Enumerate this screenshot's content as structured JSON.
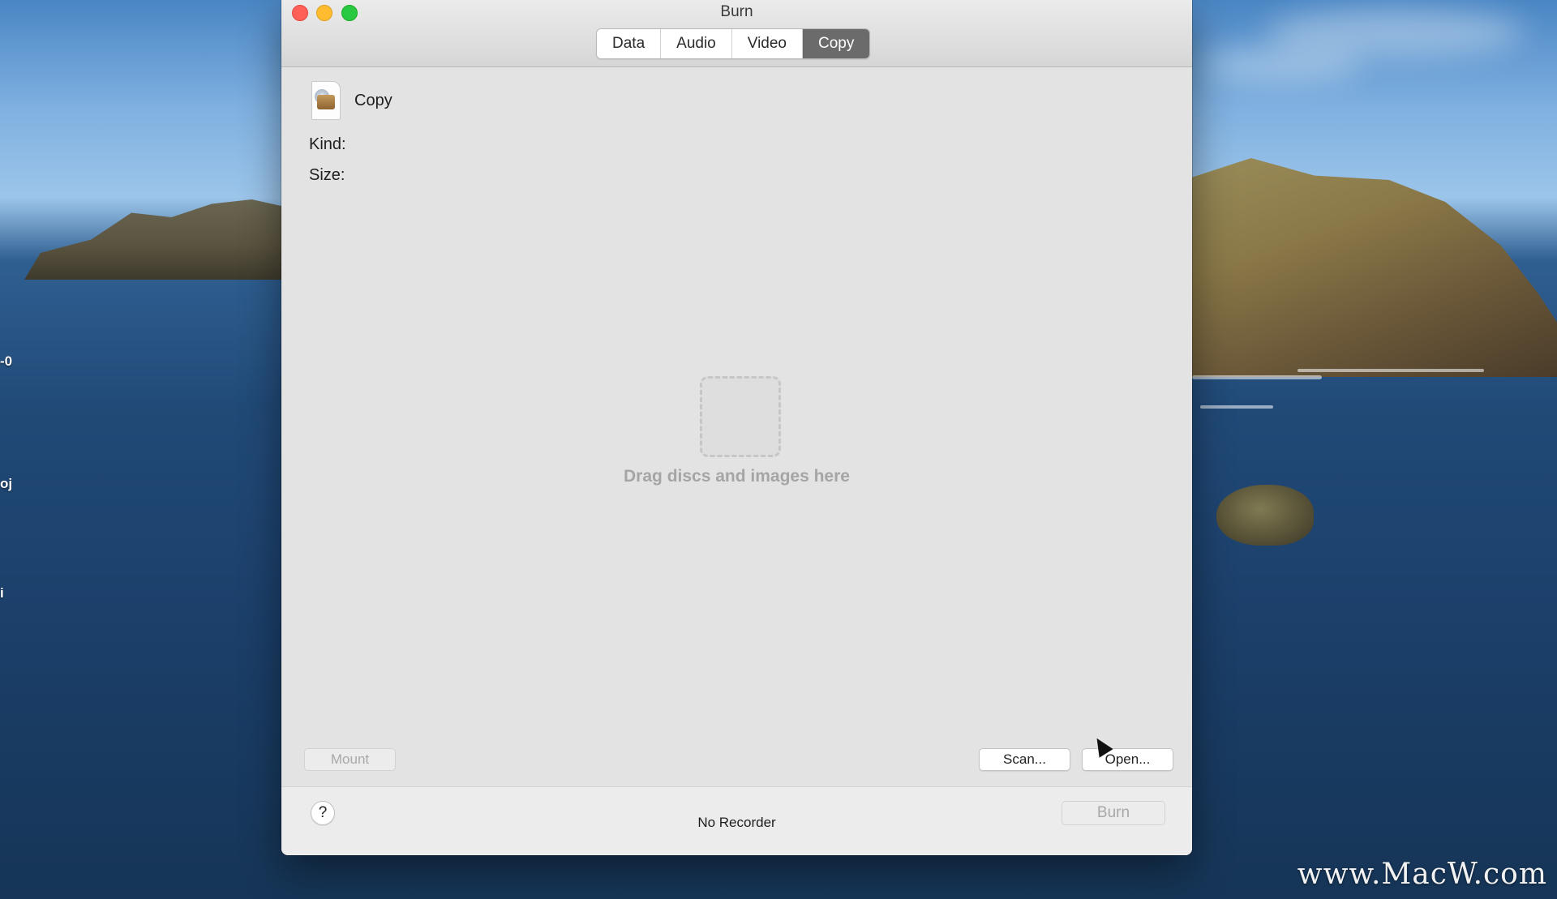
{
  "window": {
    "title": "Burn",
    "tabs": [
      {
        "label": "Data",
        "active": false
      },
      {
        "label": "Audio",
        "active": false
      },
      {
        "label": "Video",
        "active": false
      },
      {
        "label": "Copy",
        "active": true
      }
    ]
  },
  "copy_panel": {
    "item_name": "Copy",
    "item_icon": "disc-image-file-icon",
    "kind_label": "Kind:",
    "size_label": "Size:",
    "drop_hint": "Drag discs and images here",
    "mount_button": {
      "label": "Mount",
      "enabled": false
    },
    "scan_button": {
      "label": "Scan...",
      "enabled": true
    },
    "open_button": {
      "label": "Open...",
      "enabled": true
    }
  },
  "bottom_bar": {
    "help_label": "?",
    "recorder_status": "No Recorder",
    "burn_button": {
      "label": "Burn",
      "enabled": false
    }
  },
  "desktop": {
    "labels": [
      "-0",
      "oj",
      "i"
    ],
    "watermark": "www.MacW.com"
  },
  "colors": {
    "active_tab": "#6b6b6b",
    "close": "#fe5f57",
    "minimize": "#febc2e",
    "maximize": "#28c840"
  }
}
